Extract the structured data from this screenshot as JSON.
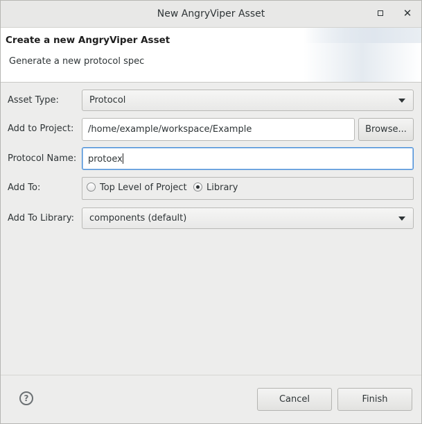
{
  "window": {
    "title": "New AngryViper Asset",
    "maximize_icon": "maximize-icon",
    "close_icon": "close-icon"
  },
  "banner": {
    "heading": "Create a new AngryViper Asset",
    "description": "Generate a new protocol spec"
  },
  "form": {
    "asset_type": {
      "label": "Asset Type:",
      "value": "Protocol"
    },
    "add_to_project": {
      "label": "Add to Project:",
      "value": "/home/example/workspace/Example",
      "browse_label": "Browse..."
    },
    "protocol_name": {
      "label": "Protocol Name:",
      "value": "protoex"
    },
    "add_to": {
      "label": "Add To:",
      "options": [
        {
          "label": "Top Level of Project",
          "selected": false
        },
        {
          "label": "Library",
          "selected": true
        }
      ]
    },
    "add_to_library": {
      "label": "Add To Library:",
      "value": "components (default)"
    }
  },
  "footer": {
    "help_icon": "help-icon",
    "cancel_label": "Cancel",
    "finish_label": "Finish"
  },
  "colors": {
    "focus_border": "#4a90d9",
    "window_bg": "#ededec"
  }
}
